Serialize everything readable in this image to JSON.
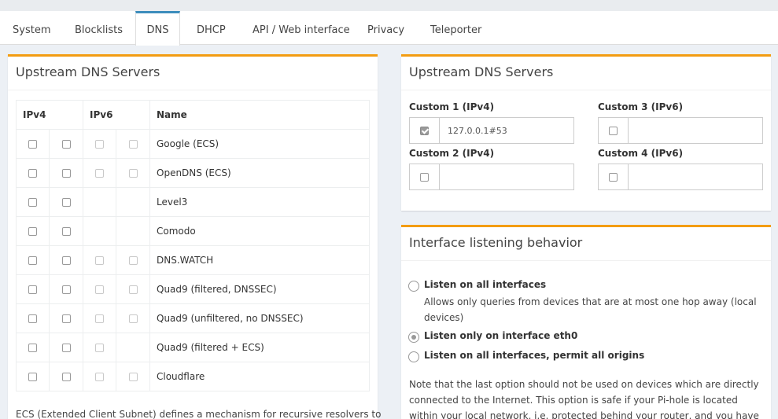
{
  "tabs": [
    "System",
    "Blocklists",
    "DNS",
    "DHCP",
    "API / Web interface",
    "Privacy",
    "Teleporter"
  ],
  "active_tab": "DNS",
  "upstream_left": {
    "title": "Upstream DNS Servers",
    "headers": {
      "ipv4": "IPv4",
      "ipv6": "IPv6",
      "name": "Name"
    },
    "rows": [
      {
        "name": "Google (ECS)",
        "ipv6": true
      },
      {
        "name": "OpenDNS (ECS)",
        "ipv6": true
      },
      {
        "name": "Level3",
        "ipv6": false
      },
      {
        "name": "Comodo",
        "ipv6": false
      },
      {
        "name": "DNS.WATCH",
        "ipv6": true
      },
      {
        "name": "Quad9 (filtered, DNSSEC)",
        "ipv6": true
      },
      {
        "name": "Quad9 (unfiltered, no DNSSEC)",
        "ipv6": true
      },
      {
        "name": "Quad9 (filtered + ECS)",
        "ipv6": "one"
      },
      {
        "name": "Cloudflare",
        "ipv6": true
      }
    ],
    "ecs_text": "ECS (Extended Client Subnet) defines a mechanism for recursive resolvers to"
  },
  "upstream_right": {
    "title": "Upstream DNS Servers",
    "custom1": {
      "label": "Custom 1 (IPv4)",
      "value": "127.0.0.1#53",
      "checked": true
    },
    "custom2": {
      "label": "Custom 2 (IPv4)",
      "value": "",
      "checked": false
    },
    "custom3": {
      "label": "Custom 3 (IPv6)",
      "value": "",
      "checked": false
    },
    "custom4": {
      "label": "Custom 4 (IPv6)",
      "value": "",
      "checked": false
    }
  },
  "interface": {
    "title": "Interface listening behavior",
    "option1": {
      "label": "Listen on all interfaces",
      "desc": "Allows only queries from devices that are at most one hop away (local devices)"
    },
    "option2": {
      "label": "Listen only on interface eth0"
    },
    "option3": {
      "label": "Listen on all interfaces, permit all origins"
    },
    "selected": 2,
    "note": "Note that the last option should not be used on devices which are directly connected to the Internet. This option is safe if your Pi-hole is located within your local network, i.e. protected behind your router, and you have not"
  },
  "colors": {
    "accent_tab": "#3c8dbc",
    "panel_border": "#f39c12"
  }
}
